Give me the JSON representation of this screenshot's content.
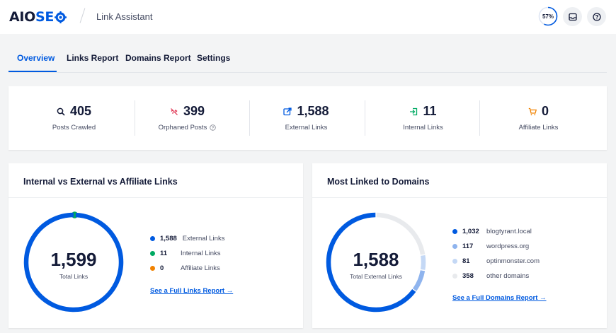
{
  "header": {
    "logo_main": "AIOSE",
    "logo_accent": "O",
    "breadcrumb": "Link Assistant",
    "score": "57%",
    "score_value": 57
  },
  "tabs": [
    {
      "label": "Overview",
      "active": true
    },
    {
      "label": "Links Report",
      "active": false
    },
    {
      "label": "Domains Report",
      "active": false
    },
    {
      "label": "Settings",
      "active": false
    }
  ],
  "stats": [
    {
      "value": "405",
      "label": "Posts Crawled",
      "icon": "search-icon",
      "color": "#141b38"
    },
    {
      "value": "399",
      "label": "Orphaned Posts",
      "icon": "unlink-icon",
      "color": "#df2a4a",
      "help": true
    },
    {
      "value": "1,588",
      "label": "External Links",
      "icon": "external-link-icon",
      "color": "#005ae0"
    },
    {
      "value": "11",
      "label": "Internal Links",
      "icon": "internal-link-icon",
      "color": "#00aa63"
    },
    {
      "value": "0",
      "label": "Affiliate Links",
      "icon": "cart-icon",
      "color": "#f18200"
    }
  ],
  "links_panel": {
    "title": "Internal vs External vs Affiliate Links",
    "total": "1,599",
    "total_label": "Total Links",
    "legend": [
      {
        "value": "1,588",
        "label": "External Links",
        "color": "#005ae0",
        "amount": 1588
      },
      {
        "value": "11",
        "label": "Internal Links",
        "color": "#00aa63",
        "amount": 11
      },
      {
        "value": "0",
        "label": "Affiliate Links",
        "color": "#f18200",
        "amount": 0
      }
    ],
    "link": "See a Full Links Report →"
  },
  "domains_panel": {
    "title": "Most Linked to Domains",
    "total": "1,588",
    "total_label": "Total External Links",
    "legend": [
      {
        "value": "1,032",
        "label": "blogtyrant.local",
        "color": "#005ae0",
        "amount": 1032
      },
      {
        "value": "117",
        "label": "wordpress.org",
        "color": "#8fb4ee",
        "amount": 117
      },
      {
        "value": "81",
        "label": "optinmonster.com",
        "color": "#c4d8f5",
        "amount": 81
      },
      {
        "value": "358",
        "label": "other domains",
        "color": "#e8eaed",
        "amount": 358
      }
    ],
    "link": "See a Full Domains Report →"
  }
}
